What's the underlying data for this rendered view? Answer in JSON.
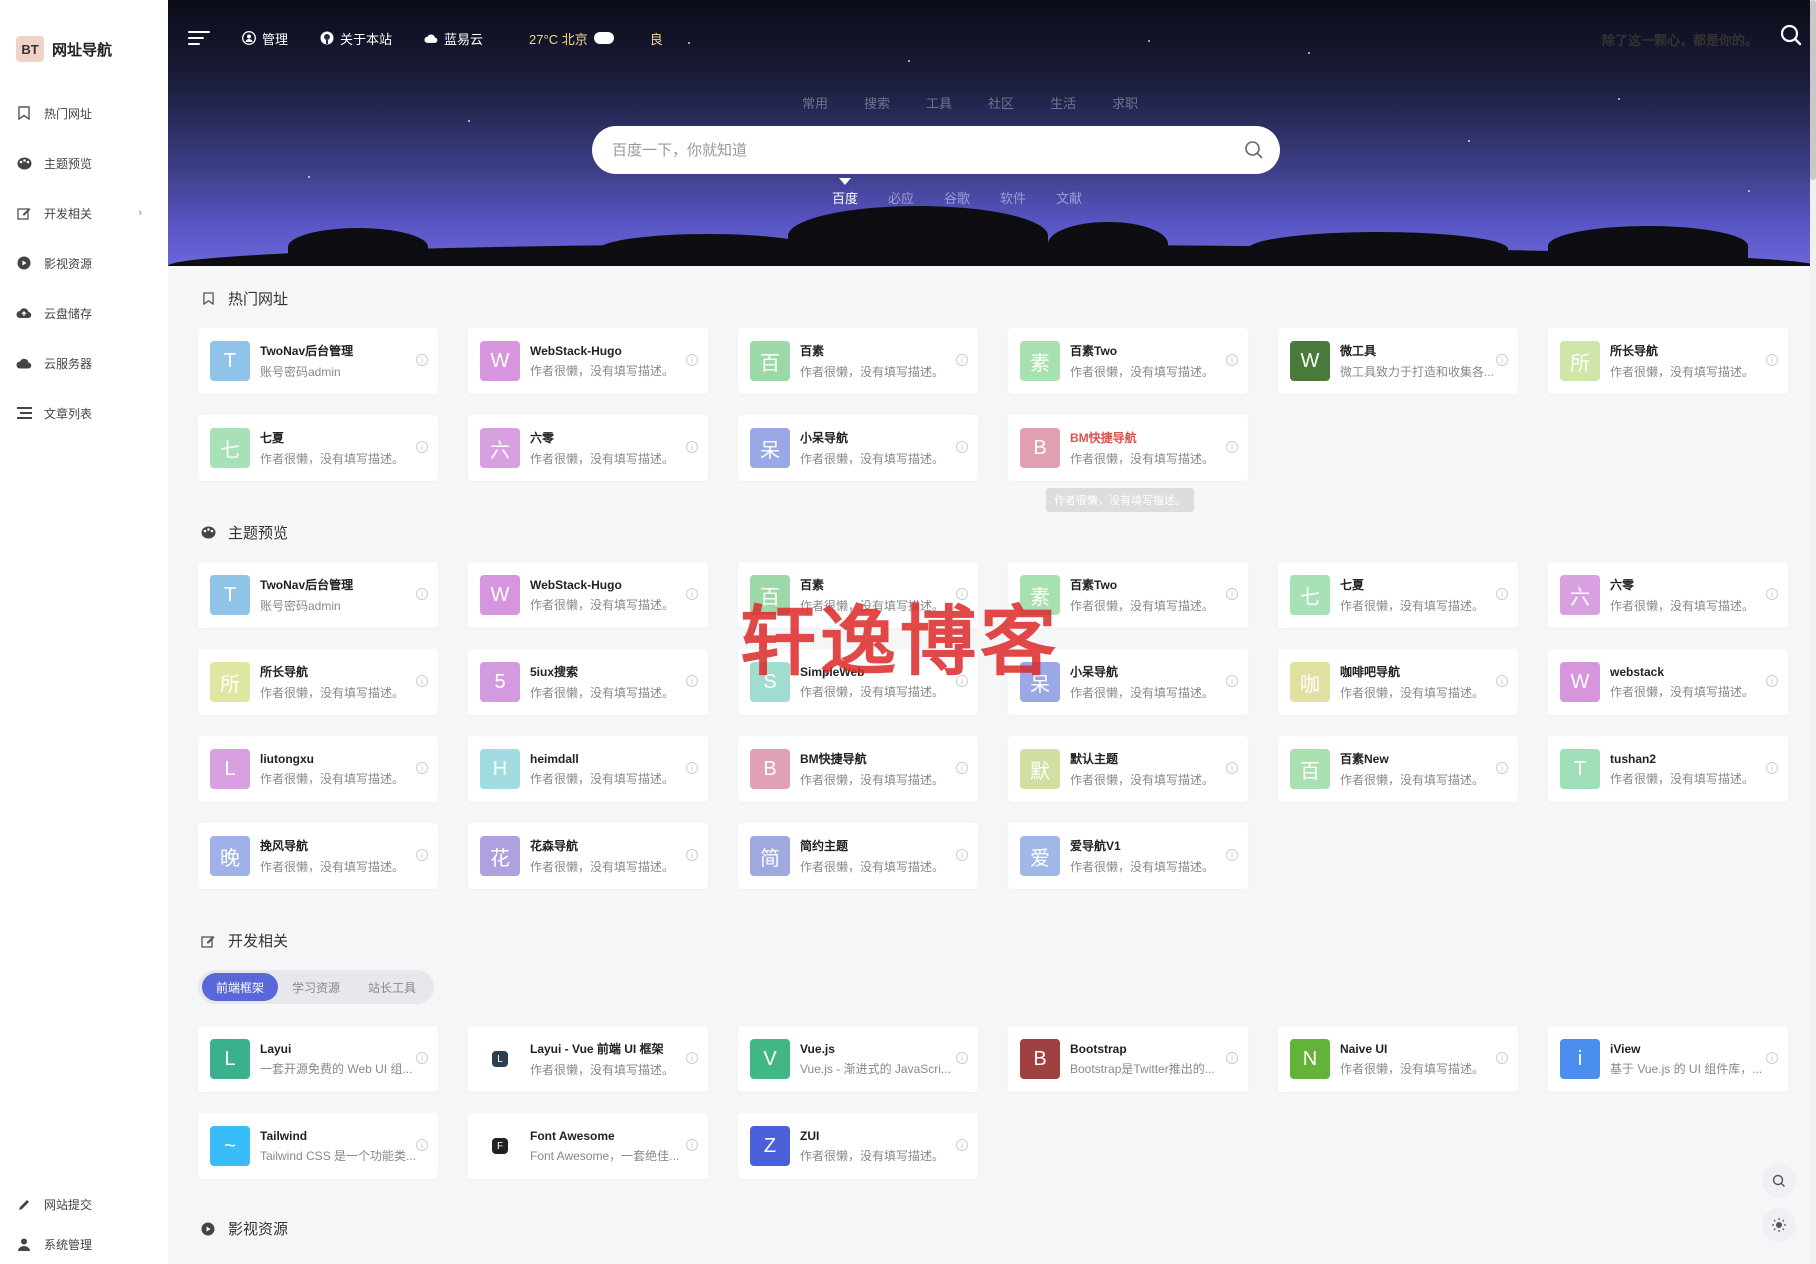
{
  "brand": {
    "logo": "BT",
    "name": "网址导航"
  },
  "sidebar": {
    "items": [
      {
        "label": "热门网址",
        "icon": "bookmark-icon"
      },
      {
        "label": "主题预览",
        "icon": "palette-icon"
      },
      {
        "label": "开发相关",
        "icon": "edit-icon",
        "caret": "›"
      },
      {
        "label": "影视资源",
        "icon": "play-icon"
      },
      {
        "label": "云盘储存",
        "icon": "cloud-upload-icon"
      },
      {
        "label": "云服务器",
        "icon": "cloud-icon"
      },
      {
        "label": "文章列表",
        "icon": "list-icon"
      }
    ],
    "bottom": [
      {
        "label": "网站提交",
        "icon": "pen-icon"
      },
      {
        "label": "系统管理",
        "icon": "user-icon"
      }
    ]
  },
  "topbar": {
    "links": [
      {
        "label": "管理",
        "icon": "user-circle-icon"
      },
      {
        "label": "关于本站",
        "icon": "github-icon"
      },
      {
        "label": "蓝易云",
        "icon": "cloud-icon"
      }
    ],
    "weather": "27°C 北京",
    "aqi": "良",
    "slogan": "除了这一颗心，都是你的。"
  },
  "search": {
    "tabs": [
      "常用",
      "搜索",
      "工具",
      "社区",
      "生活",
      "求职"
    ],
    "placeholder": "百度一下，你就知道",
    "engines": [
      "百度",
      "必应",
      "谷歌",
      "软件",
      "文献"
    ],
    "active_engine": "百度"
  },
  "sections": {
    "hot": {
      "title": "热门网址",
      "cards": [
        {
          "avatar": "T",
          "color": "#8fc3e8",
          "name": "TwoNav后台管理",
          "desc": "账号密码admin"
        },
        {
          "avatar": "W",
          "color": "#d596de",
          "name": "WebStack-Hugo",
          "desc": "作者很懒，没有填写描述。"
        },
        {
          "avatar": "百",
          "color": "#9dd9a8",
          "name": "百素",
          "desc": "作者很懒，没有填写描述。"
        },
        {
          "avatar": "素",
          "color": "#a8e0b0",
          "name": "百素Two",
          "desc": "作者很懒，没有填写描述。"
        },
        {
          "avatar": "W",
          "color": "#4a7a3a",
          "name": "微工具",
          "desc": "微工具致力于打造和收集各..."
        },
        {
          "avatar": "所",
          "color": "#cfe6a8",
          "name": "所长导航",
          "desc": "作者很懒，没有填写描述。"
        },
        {
          "avatar": "七",
          "color": "#a8e0b8",
          "name": "七夏",
          "desc": "作者很懒，没有填写描述。"
        },
        {
          "avatar": "六",
          "color": "#d8a0e0",
          "name": "六零",
          "desc": "作者很懒，没有填写描述。"
        },
        {
          "avatar": "呆",
          "color": "#9aa8e6",
          "name": "小呆导航",
          "desc": "作者很懒，没有填写描述。"
        },
        {
          "avatar": "B",
          "color": "#e0a0b0",
          "name": "BM快捷导航",
          "desc": "作者很懒，没有填写描述。",
          "highlight": true
        }
      ],
      "tooltip": "作者很懒，没有填写描述。"
    },
    "theme": {
      "title": "主题预览",
      "cards": [
        {
          "avatar": "T",
          "color": "#8fc3e8",
          "name": "TwoNav后台管理",
          "desc": "账号密码admin"
        },
        {
          "avatar": "W",
          "color": "#d596de",
          "name": "WebStack-Hugo",
          "desc": "作者很懒，没有填写描述。"
        },
        {
          "avatar": "百",
          "color": "#9dd9a8",
          "name": "百素",
          "desc": "作者很懒，没有填写描述。"
        },
        {
          "avatar": "素",
          "color": "#a8e0b0",
          "name": "百素Two",
          "desc": "作者很懒，没有填写描述。"
        },
        {
          "avatar": "七",
          "color": "#a8e0b8",
          "name": "七夏",
          "desc": "作者很懒，没有填写描述。"
        },
        {
          "avatar": "六",
          "color": "#d8a0e0",
          "name": "六零",
          "desc": "作者很懒，没有填写描述。"
        },
        {
          "avatar": "所",
          "color": "#dfe6a0",
          "name": "所长导航",
          "desc": "作者很懒，没有填写描述。"
        },
        {
          "avatar": "5",
          "color": "#d39ae0",
          "name": "5iux搜索",
          "desc": "作者很懒，没有填写描述。"
        },
        {
          "avatar": "S",
          "color": "#a0dcd0",
          "name": "SimpleWeb",
          "desc": "作者很懒，没有填写描述。"
        },
        {
          "avatar": "呆",
          "color": "#9aa8e6",
          "name": "小呆导航",
          "desc": "作者很懒，没有填写描述。"
        },
        {
          "avatar": "咖",
          "color": "#e0e0a0",
          "name": "咖啡吧导航",
          "desc": "作者很懒，没有填写描述。"
        },
        {
          "avatar": "W",
          "color": "#d596de",
          "name": "webstack",
          "desc": "作者很懒，没有填写描述。"
        },
        {
          "avatar": "L",
          "color": "#d8a0e0",
          "name": "liutongxu",
          "desc": "作者很懒，没有填写描述。"
        },
        {
          "avatar": "H",
          "color": "#a0dce0",
          "name": "heimdall",
          "desc": "作者很懒，没有填写描述。"
        },
        {
          "avatar": "B",
          "color": "#e0a0b8",
          "name": "BM快捷导航",
          "desc": "作者很懒，没有填写描述。"
        },
        {
          "avatar": "默",
          "color": "#d0e0a0",
          "name": "默认主题",
          "desc": "作者很懒，没有填写描述。"
        },
        {
          "avatar": "百",
          "color": "#a8e0b0",
          "name": "百素New",
          "desc": "作者很懒，没有填写描述。"
        },
        {
          "avatar": "T",
          "color": "#a0e0b8",
          "name": "tushan2",
          "desc": "作者很懒，没有填写描述。"
        },
        {
          "avatar": "晚",
          "color": "#a0b0e8",
          "name": "挽风导航",
          "desc": "作者很懒，没有填写描述。"
        },
        {
          "avatar": "花",
          "color": "#b0a0e0",
          "name": "花森导航",
          "desc": "作者很懒，没有填写描述。"
        },
        {
          "avatar": "简",
          "color": "#a0a8e0",
          "name": "简约主题",
          "desc": "作者很懒，没有填写描述。"
        },
        {
          "avatar": "爱",
          "color": "#a0b8e8",
          "name": "爱导航V1",
          "desc": "作者很懒，没有填写描述。"
        }
      ]
    },
    "dev": {
      "title": "开发相关",
      "tabs": [
        "前端框架",
        "学习资源",
        "站长工具"
      ],
      "active_tab": "前端框架",
      "cards": [
        {
          "avatar": "L",
          "color": "#3bb08f",
          "name": "Layui",
          "desc": "一套开源免费的 Web UI 组..."
        },
        {
          "avatar": "L",
          "color": "#2c3e50",
          "name": "Layui - Vue 前端 UI 框架",
          "desc": "作者很懒，没有填写描述。",
          "small": true
        },
        {
          "avatar": "V",
          "color": "#41b883",
          "name": "Vue.js",
          "desc": "Vue.js - 渐进式的 JavaScri..."
        },
        {
          "avatar": "B",
          "color": "#a04040",
          "name": "Bootstrap",
          "desc": "Bootstrap是Twitter推出的..."
        },
        {
          "avatar": "N",
          "color": "#63b33a",
          "name": "Naive UI",
          "desc": "作者很懒，没有填写描述。"
        },
        {
          "avatar": "i",
          "color": "#4a8ef0",
          "name": "iView",
          "desc": "基于 Vue.js 的 UI 组件库，..."
        },
        {
          "avatar": "~",
          "color": "#38bdf8",
          "name": "Tailwind",
          "desc": "Tailwind CSS 是一个功能类..."
        },
        {
          "avatar": "F",
          "color": "#222222",
          "name": "Font Awesome",
          "desc": "Font Awesome，一套绝佳...",
          "small": true
        },
        {
          "avatar": "Z",
          "color": "#4a60d8",
          "name": "ZUI",
          "desc": "作者很懒，没有填写描述。"
        }
      ]
    },
    "video": {
      "title": "影视资源"
    }
  },
  "watermark": "轩逸博客"
}
